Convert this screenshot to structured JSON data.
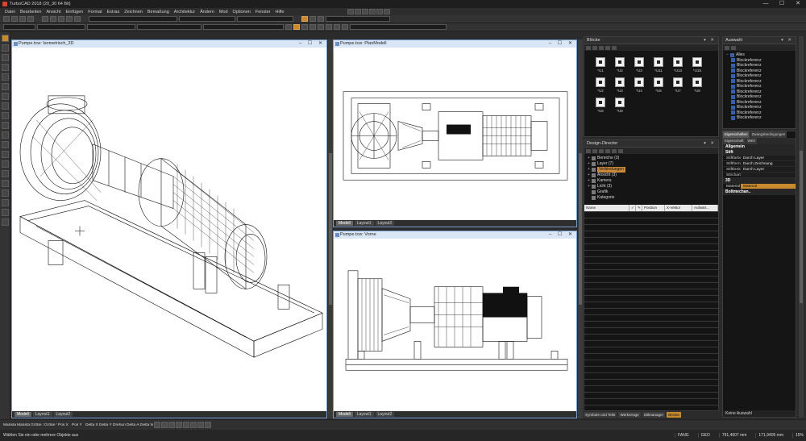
{
  "app": {
    "title": "TurboCAD 2018 (20_30 64 Bit)",
    "window_controls": [
      "—",
      "☐",
      "✕"
    ]
  },
  "menu": [
    "Datei",
    "Bearbeiten",
    "Ansicht",
    "Einfügen",
    "Format",
    "Extras",
    "Zeichnen",
    "Bemaßung",
    "Architektur",
    "Ändern",
    "Mod",
    "Optionen",
    "Fenster",
    "Hilfe"
  ],
  "viewports": {
    "iso": {
      "title": "Pumpe.tcw: Isometrisch_3D",
      "tabs": [
        "Modell",
        "Layout1",
        "Layout2"
      ]
    },
    "plan": {
      "title": "Pumpe.tcw: PlanModell",
      "tabs": [
        "Modell",
        "Layout1",
        "Layout2"
      ]
    },
    "front": {
      "title": "Pumpe.tcw: Vorne",
      "tabs": [
        "Modell",
        "Layout1",
        "Layout2"
      ]
    }
  },
  "blocks_panel": {
    "title": "Blöcke",
    "items": [
      "*U1",
      "*U2",
      "*U3",
      "*U11",
      "*U13",
      "*U15",
      "*U2",
      "*U3",
      "*U4",
      "*U6",
      "*U7",
      "*U8",
      "*U6",
      "*U9"
    ]
  },
  "design_director": {
    "title": "Design-Director",
    "tree": [
      {
        "label": "Bereiche (3)",
        "hl": false
      },
      {
        "label": "Layer (7)",
        "hl": false
      },
      {
        "label": "Verbindungen",
        "hl": true
      },
      {
        "label": "Ansicht (3)",
        "hl": false
      },
      {
        "label": "Kamera",
        "hl": false
      },
      {
        "label": "Licht (3)",
        "hl": false
      },
      {
        "label": "Grafik",
        "hl": false
      },
      {
        "label": "Kategorie",
        "hl": false
      }
    ],
    "columns": [
      "Name",
      "✓",
      "✎",
      "Position",
      "X-Vektor",
      "Aufwärt..."
    ]
  },
  "selection_panel": {
    "title": "Auswahl",
    "root": "Alles",
    "items": [
      "Blockreferenz",
      "Blockreferenz",
      "Blockreferenz",
      "Blockreferenz",
      "Blockreferenz",
      "Blockreferenz",
      "Blockreferenz",
      "Blockreferenz",
      "Blockreferenz",
      "Blockreferenz",
      "Blockreferenz",
      "Blockreferenz"
    ]
  },
  "properties_panel": {
    "tabs": [
      "Eigenschaften",
      "Zwangsbedingungen"
    ],
    "subtabs": [
      "Eigenschaft",
      "Wert"
    ],
    "groups": [
      {
        "name": "Allgemein",
        "rows": []
      },
      {
        "name": "Stift",
        "rows": [
          {
            "k": "Stiftfarbe",
            "v": "Durch Layer"
          },
          {
            "k": "Stiftform",
            "v": "Durch Zeichnung"
          },
          {
            "k": "Stiftbreite",
            "v": "Durch Layer"
          },
          {
            "k": "Strichart",
            "v": ""
          }
        ]
      },
      {
        "name": "3D",
        "rows": [
          {
            "k": "Material",
            "v": "Material"
          }
        ]
      },
      {
        "name": "Boltmechan..",
        "rows": []
      }
    ],
    "footer": "Keine Auswahl"
  },
  "dock_tabs_mid": [
    "Symbole und Teile",
    "Werkzeuge",
    "Stilmanager",
    "Blöcke"
  ],
  "coords": [
    "Maßstab X",
    "Maßstab Y",
    "Größe X",
    "Größe Y",
    "Pos X",
    "Pos Y",
    "Delta X",
    "Delta Y",
    "Drehung",
    "Delta Abst",
    "Delta Winkel"
  ],
  "status": {
    "message": "Wählen Sie ein oder mehrere Objekte aus",
    "segments": [
      "FANG",
      "GEO",
      "791,4607 mm",
      "171,9405 mm",
      "15%"
    ]
  }
}
